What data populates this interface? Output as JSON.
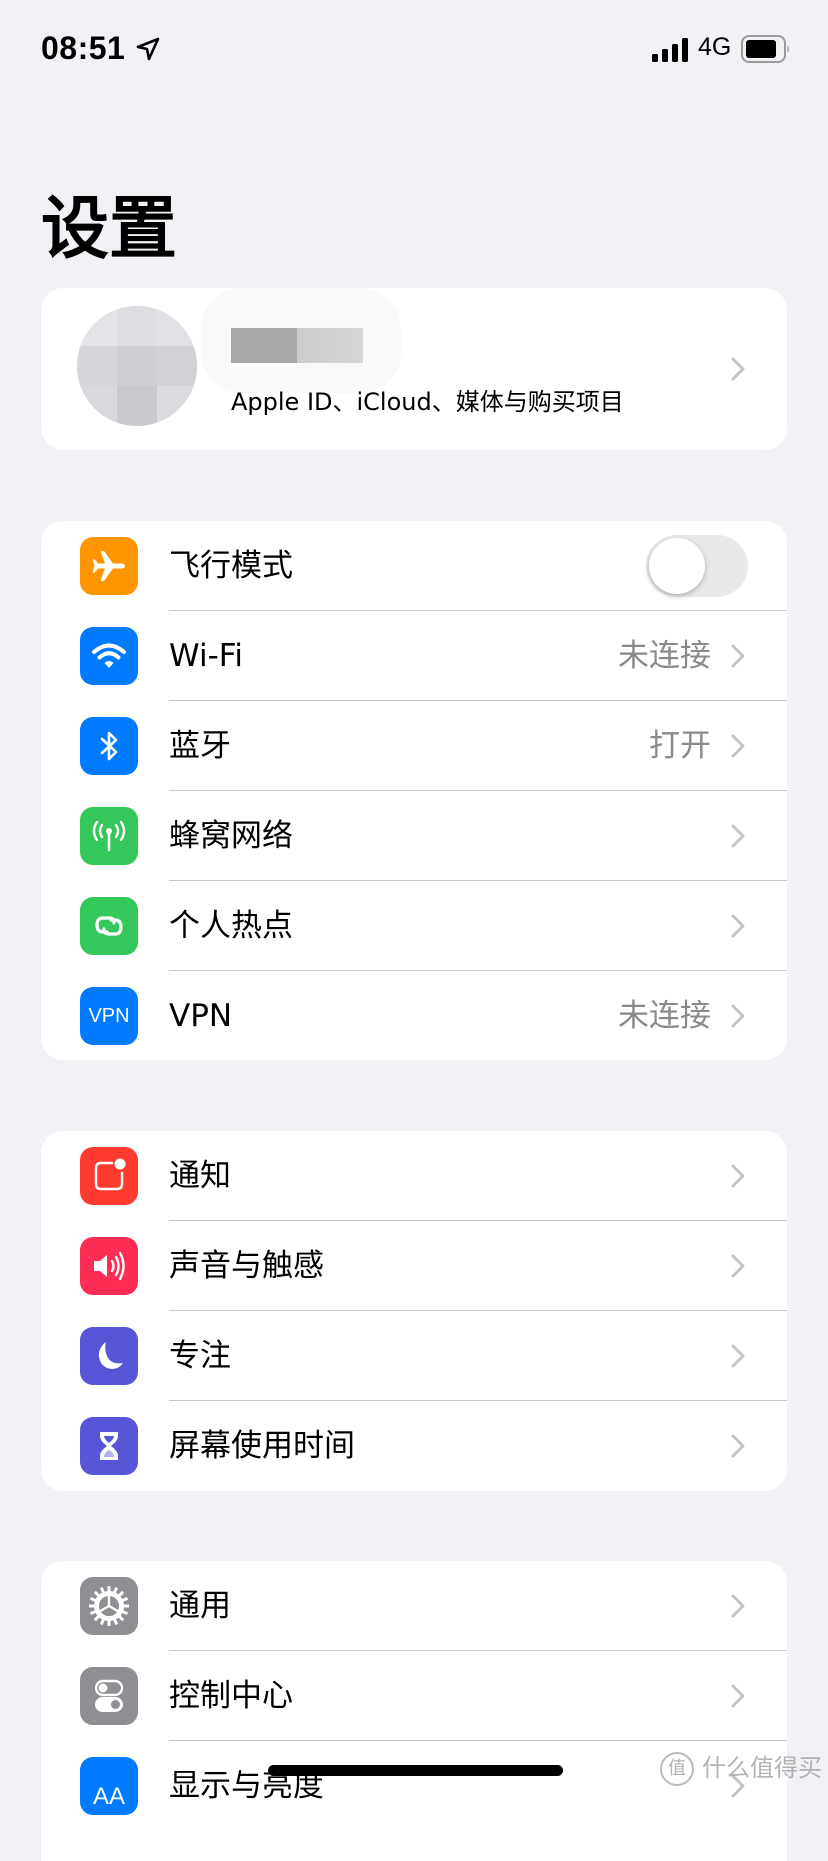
{
  "status_bar": {
    "time": "08:51",
    "location_icon": "location-arrow-icon",
    "signal_icon": "cellular-signal-icon",
    "network_type": "4G",
    "battery_icon": "battery-icon"
  },
  "header": {
    "title": "设置"
  },
  "profile": {
    "name": "",
    "subtitle": "Apple ID、iCloud、媒体与购买项目",
    "avatar_icon": "avatar-blurred"
  },
  "sections": [
    {
      "rows": [
        {
          "label": "飞行模式",
          "icon": "airplane-icon",
          "color": "#ff9500",
          "toggle": true,
          "toggle_on": false
        },
        {
          "label": "Wi-Fi",
          "icon": "wifi-icon",
          "color": "#007aff",
          "value": "未连接"
        },
        {
          "label": "蓝牙",
          "icon": "bluetooth-icon",
          "color": "#007aff",
          "value": "打开"
        },
        {
          "label": "蜂窝网络",
          "icon": "cellular-antenna-icon",
          "color": "#34c759"
        },
        {
          "label": "个人热点",
          "icon": "hotspot-link-icon",
          "color": "#34c759"
        },
        {
          "label": "VPN",
          "icon": "vpn-icon",
          "icon_text": "VPN",
          "color": "#007aff",
          "value": "未连接"
        }
      ]
    },
    {
      "rows": [
        {
          "label": "通知",
          "icon": "notification-icon",
          "color": "#ff3b30"
        },
        {
          "label": "声音与触感",
          "icon": "speaker-icon",
          "color": "#ff2d55"
        },
        {
          "label": "专注",
          "icon": "moon-icon",
          "color": "#5856d6"
        },
        {
          "label": "屏幕使用时间",
          "icon": "hourglass-icon",
          "color": "#5856d6"
        }
      ]
    },
    {
      "rows": [
        {
          "label": "通用",
          "icon": "gear-icon",
          "color": "#8e8e93"
        },
        {
          "label": "控制中心",
          "icon": "switches-icon",
          "color": "#8e8e93"
        },
        {
          "label": "显示与亮度",
          "icon": "text-size-icon",
          "icon_text": "AA",
          "color": "#007aff"
        }
      ]
    }
  ],
  "watermark": {
    "logo": "值",
    "text": "什么值得买"
  }
}
